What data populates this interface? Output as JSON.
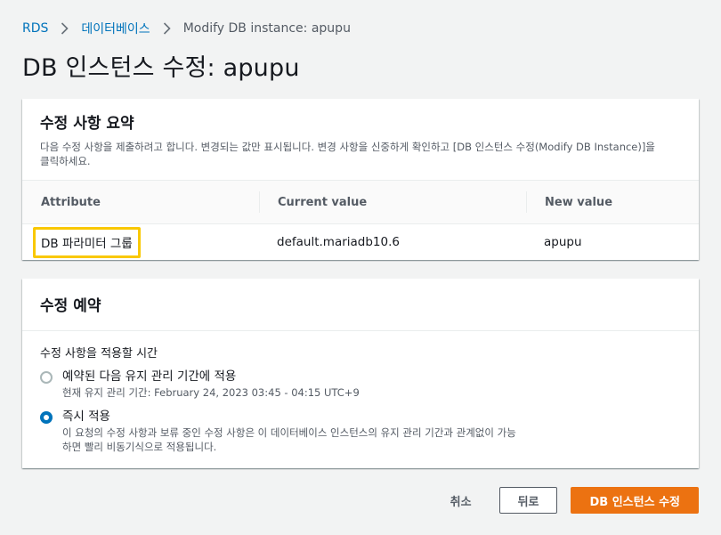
{
  "breadcrumb": {
    "items": [
      "RDS",
      "데이터베이스",
      "Modify DB instance: apupu"
    ]
  },
  "page": {
    "title": "DB 인스턴스 수정: apupu"
  },
  "summary": {
    "title": "수정 사항 요약",
    "description": "다음 수정 사항을 제출하려고 합니다. 변경되는 값만 표시됩니다. 변경 사항을 신중하게 확인하고 [DB 인스턴스 수정(Modify DB Instance)]을 클릭하세요.",
    "columns": [
      "Attribute",
      "Current value",
      "New value"
    ],
    "rows": [
      {
        "attribute": "DB 파라미터 그룹",
        "current": "default.mariadb10.6",
        "new": "apupu"
      }
    ],
    "highlight_color": "#f9c800"
  },
  "schedule": {
    "title": "수정 예약",
    "field_label": "수정 사항을 적용할 시간",
    "options": [
      {
        "label": "예약된 다음 유지 관리 기간에 적용",
        "description": "현재 유지 관리 기간: February 24, 2023 03:45 - 04:15 UTC+9",
        "selected": false
      },
      {
        "label": "즉시 적용",
        "description": "이 요청의 수정 사항과 보류 중인 수정 사항은 이 데이터베이스 인스턴스의 유지 관리 기간과 관계없이 가능하면 빨리 비동기식으로 적용됩니다.",
        "selected": true
      }
    ]
  },
  "actions": {
    "cancel_label": "취소",
    "back_label": "뒤로",
    "submit_label": "DB 인스턴스 수정"
  },
  "colors": {
    "link": "#0073bb",
    "primary": "#ec7211",
    "background": "#f2f3f3"
  }
}
